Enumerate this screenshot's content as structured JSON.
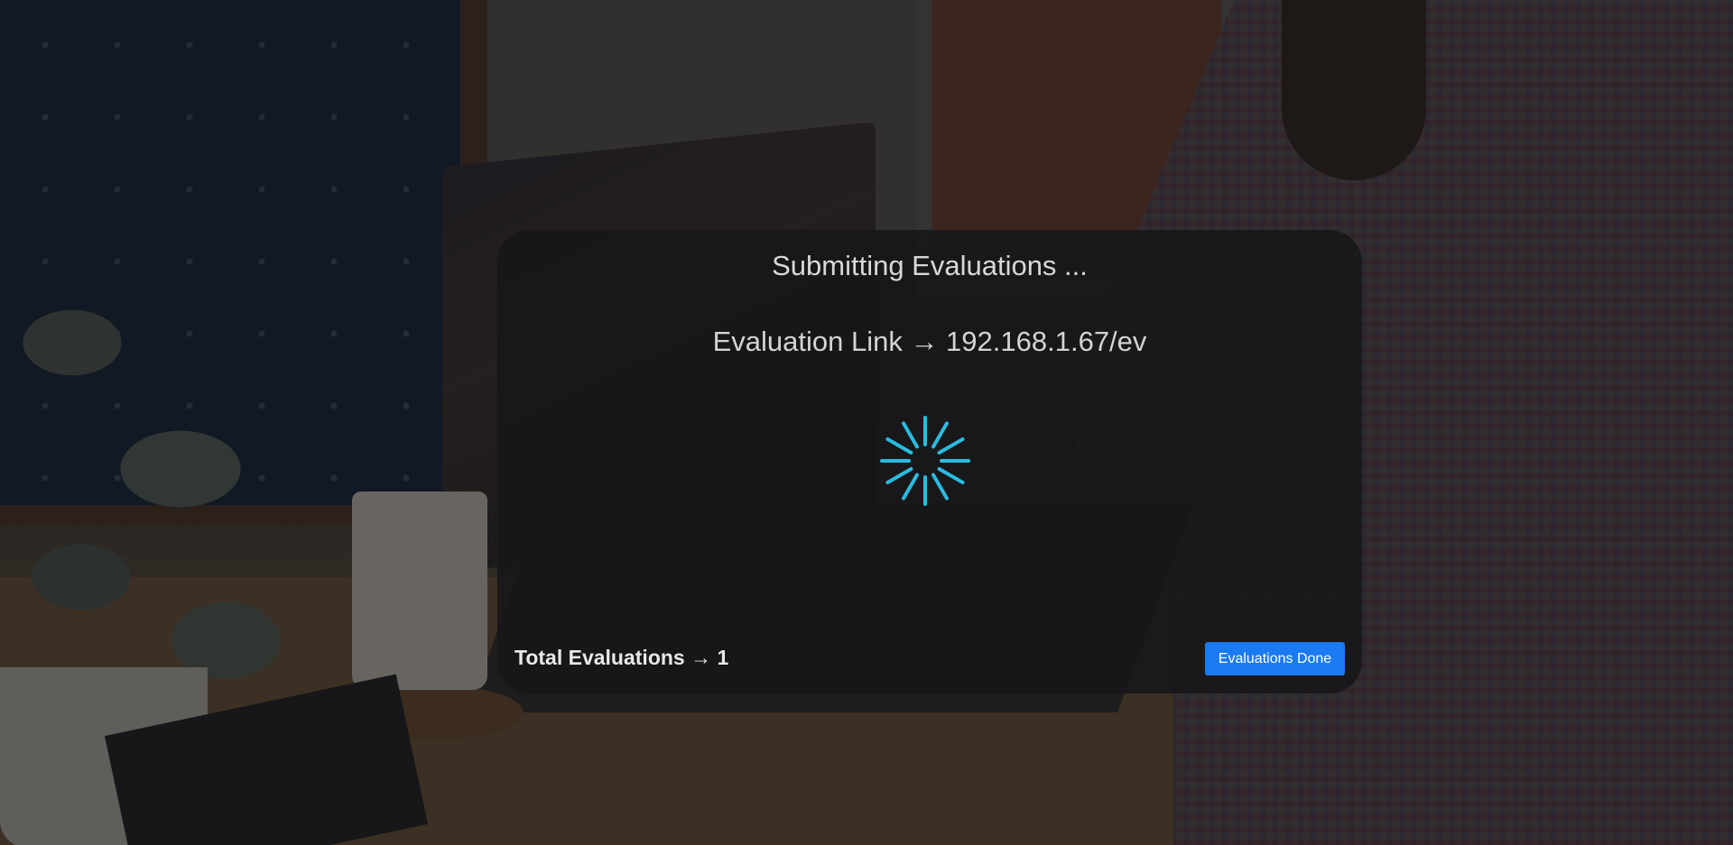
{
  "modal": {
    "title": "Submitting Evaluations ...",
    "evaluation_link_label": "Evaluation Link",
    "evaluation_link_arrow": "→",
    "evaluation_link_value": "192.168.1.67/ev",
    "evaluation_link_text": "Evaluation Link → 192.168.1.67/ev",
    "spinner_icon": "loading-spinner-icon",
    "spinner_color": "#2bbbe0",
    "total_text": "Total Evaluations → 1",
    "total_label": "Total Evaluations",
    "total_count": "1",
    "done_button_label": "Evaluations Done",
    "done_button_color": "#1a7af2"
  }
}
